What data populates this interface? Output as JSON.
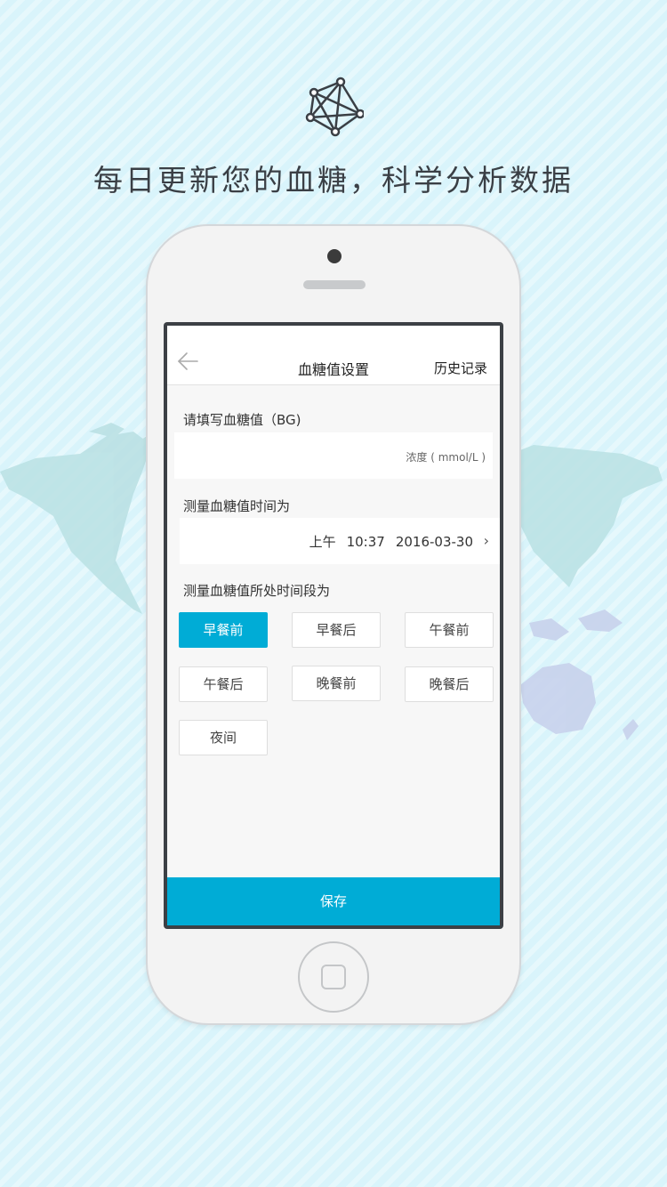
{
  "headline": "每日更新您的血糖，科学分析数据",
  "colors": {
    "accent": "#00acd6",
    "background": "#d9f4fb",
    "map": "#b9dfe4"
  },
  "icons": {
    "hero": "network-polygon-icon",
    "back": "arrow-left-icon",
    "chevron": "chevron-right-icon",
    "home": "home-button-icon"
  },
  "screen": {
    "nav": {
      "title": "血糖值设置",
      "history": "历史记录"
    },
    "bg_section": {
      "label": "请填写血糖值（BG)",
      "unit_hint": "浓度 ( mmol/L )"
    },
    "time_section": {
      "label": "测量血糖值时间为",
      "ampm": "上午",
      "time": "10:37",
      "date": "2016-03-30",
      "chevron": "›"
    },
    "period_section": {
      "label": "测量血糖值所处时间段为",
      "options": [
        {
          "label": "早餐前",
          "selected": true
        },
        {
          "label": "早餐后",
          "selected": false
        },
        {
          "label": "午餐前",
          "selected": false
        },
        {
          "label": "午餐后",
          "selected": false
        },
        {
          "label": "晚餐前",
          "selected": false
        },
        {
          "label": "晚餐后",
          "selected": false
        },
        {
          "label": "夜间",
          "selected": false
        }
      ]
    },
    "save_label": "保存"
  }
}
